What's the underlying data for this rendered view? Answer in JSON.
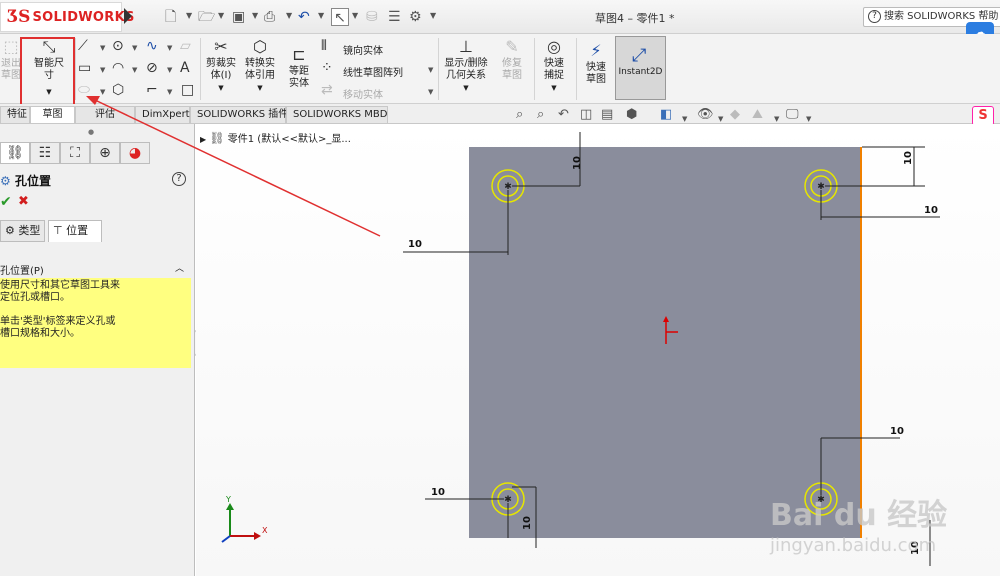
{
  "app": {
    "brand": "SOLIDWORKS",
    "document_title": "草图4 – 零件1 *",
    "help_label": "搜索 SOLIDWORKS 帮助"
  },
  "ribbon": {
    "exit_sketch": "退出草图",
    "smart_dimension": "智能尺寸",
    "trim_entities": "剪裁实体(I)",
    "convert_entities": "转换实体引用",
    "offset_entities": "等距实体",
    "mirror_entities": "镜向实体",
    "linear_pattern": "线性草图阵列",
    "move_entities": "移动实体",
    "display_delete_relations": "显示/删除几何关系",
    "repair_sketch": "修复草图",
    "quick_snaps": "快速捕捉",
    "rapid_sketch": "快速草图",
    "instant2d": "Instant2D"
  },
  "tabs": [
    "特征",
    "草图",
    "评估",
    "DimXpert",
    "SOLIDWORKS 插件",
    "SOLIDWORKS MBD"
  ],
  "active_tab": "草图",
  "left_panel": {
    "title": "孔位置",
    "subtabs": [
      "类型",
      "位置"
    ],
    "active_subtab": "位置",
    "section_title": "孔位置(P)",
    "note_lines": [
      "使用尺寸和其它草图工具来\n定位孔或槽口。",
      "单击'类型'标签来定义孔或\n槽口规格和大小。"
    ]
  },
  "tree": {
    "item": "零件1  (默认<<默认>_显..."
  },
  "drawing": {
    "plate_color": "#8a8d9c",
    "hole_ring_color": "#e6e600",
    "dimensions": [
      "10",
      "10",
      "10",
      "10",
      "10",
      "10",
      "10",
      "10"
    ],
    "axis_y": "Y",
    "axis_x": "X"
  },
  "watermark": {
    "text": "Bai du 经验",
    "url": "jingyan.baidu.com"
  },
  "colors": {
    "accent_red": "#e03030",
    "brand_red": "#d22222"
  }
}
